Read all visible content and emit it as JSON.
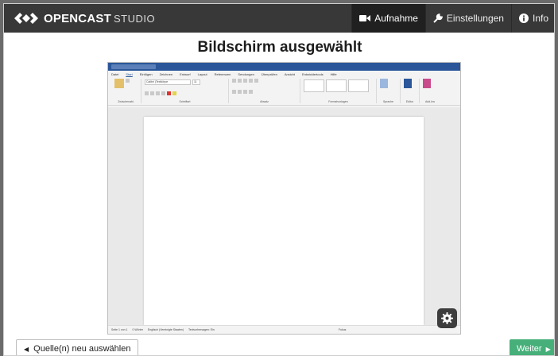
{
  "app": {
    "brand_name": "OPENCAST",
    "brand_sub": "STUDIO"
  },
  "nav": [
    {
      "label": "Aufnahme",
      "icon": "video-camera-icon"
    },
    {
      "label": "Einstellungen",
      "icon": "wrench-icon"
    },
    {
      "label": "Info",
      "icon": "info-icon"
    }
  ],
  "main": {
    "title": "Bildschirm ausgewählt"
  },
  "buttons": {
    "back_label": "Quelle(n) neu auswählen",
    "next_label": "Weiter"
  },
  "preview": {
    "menu": [
      "Datei",
      "Start",
      "Einfügen",
      "Zeichnen",
      "Entwurf",
      "Layout",
      "Referenzen",
      "Sendungen",
      "Überprüfen",
      "Ansicht",
      "Entwicklertools",
      "Hilfe"
    ],
    "ribbon_groups": [
      "Zwischenabl.",
      "Schriftart",
      "Absatz",
      "Formatvorlagen",
      "Sprache",
      "Editor",
      "Add-Ins"
    ],
    "font_box": "Calibri (Textkörpe",
    "font_size": "11",
    "status": [
      "Seite 1 von 1",
      "0 Wörter",
      "Englisch (Vereinigte Staaten)",
      "Textvorhersagen: Ein",
      "Fokus"
    ]
  },
  "colors": {
    "topbar": "#383838",
    "accent_green": "#47af7a",
    "word_blue": "#2b579a"
  }
}
